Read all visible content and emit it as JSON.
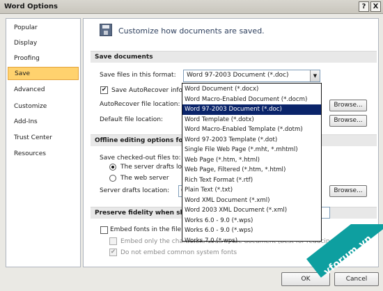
{
  "window": {
    "title": "Word Options",
    "help": "?",
    "close": "X"
  },
  "sidebar": {
    "items": [
      {
        "label": "Popular"
      },
      {
        "label": "Display"
      },
      {
        "label": "Proofing"
      },
      {
        "label": "Save",
        "selected": true
      },
      {
        "label": "Advanced"
      },
      {
        "label": "Customize"
      },
      {
        "label": "Add-Ins"
      },
      {
        "label": "Trust Center"
      },
      {
        "label": "Resources"
      }
    ]
  },
  "header": {
    "icon": "save-disk-icon",
    "text": "Customize how documents are saved."
  },
  "save_documents": {
    "section_title": "Save documents",
    "format_label": "Save files in this format:",
    "format_value": "Word 97-2003 Document (*.doc)",
    "autorecover_label": "Save AutoRecover inform",
    "autorecover_checked": true,
    "autorecover_location_label": "AutoRecover file location:",
    "default_location_label": "Default file location:",
    "browse_label": "Browse..."
  },
  "offline": {
    "section_title": "Offline editing options for do",
    "save_checked_out_label": "Save checked-out files to:",
    "server_drafts_option": "The server drafts loca",
    "web_server_option": "The web server",
    "server_drafts_location_label": "Server drafts location:",
    "server_drafts_path": "C:\\U",
    "browse_label": "Browse..."
  },
  "fidelity": {
    "section_title": "Preserve fidelity when sharin",
    "embed_fonts_label": "Embed fonts in the file",
    "embed_only_label": "Embed only the characters used in the document (best for reducing file size)",
    "no_common_fonts_label": "Do not embed common system fonts"
  },
  "dropdown": {
    "options": [
      "Word Document (*.docx)",
      "Word Macro-Enabled Document (*.docm)",
      "Word 97-2003 Document (*.doc)",
      "Word Template (*.dotx)",
      "Word Macro-Enabled Template (*.dotm)",
      "Word 97-2003 Template (*.dot)",
      "Single File Web Page (*.mht, *.mhtml)",
      "Web Page (*.htm, *.html)",
      "Web Page, Filtered (*.htm, *.html)",
      "Rich Text Format (*.rtf)",
      "Plain Text (*.txt)",
      "Word XML Document (*.xml)",
      "Word 2003 XML Document (*.xml)",
      "Works 6.0 - 9.0 (*.wps)",
      "Works 6.0 - 9.0 (*.wps)",
      "Works 7.0 (*.wps)"
    ],
    "selected_index": 2
  },
  "footer": {
    "ok": "OK",
    "cancel": "Cancel"
  },
  "watermark": {
    "text": "vforum.vn"
  },
  "colors": {
    "selection": "#0a246a",
    "nav_selected": "#ffd26e",
    "watermark": "#0e9fa0"
  }
}
